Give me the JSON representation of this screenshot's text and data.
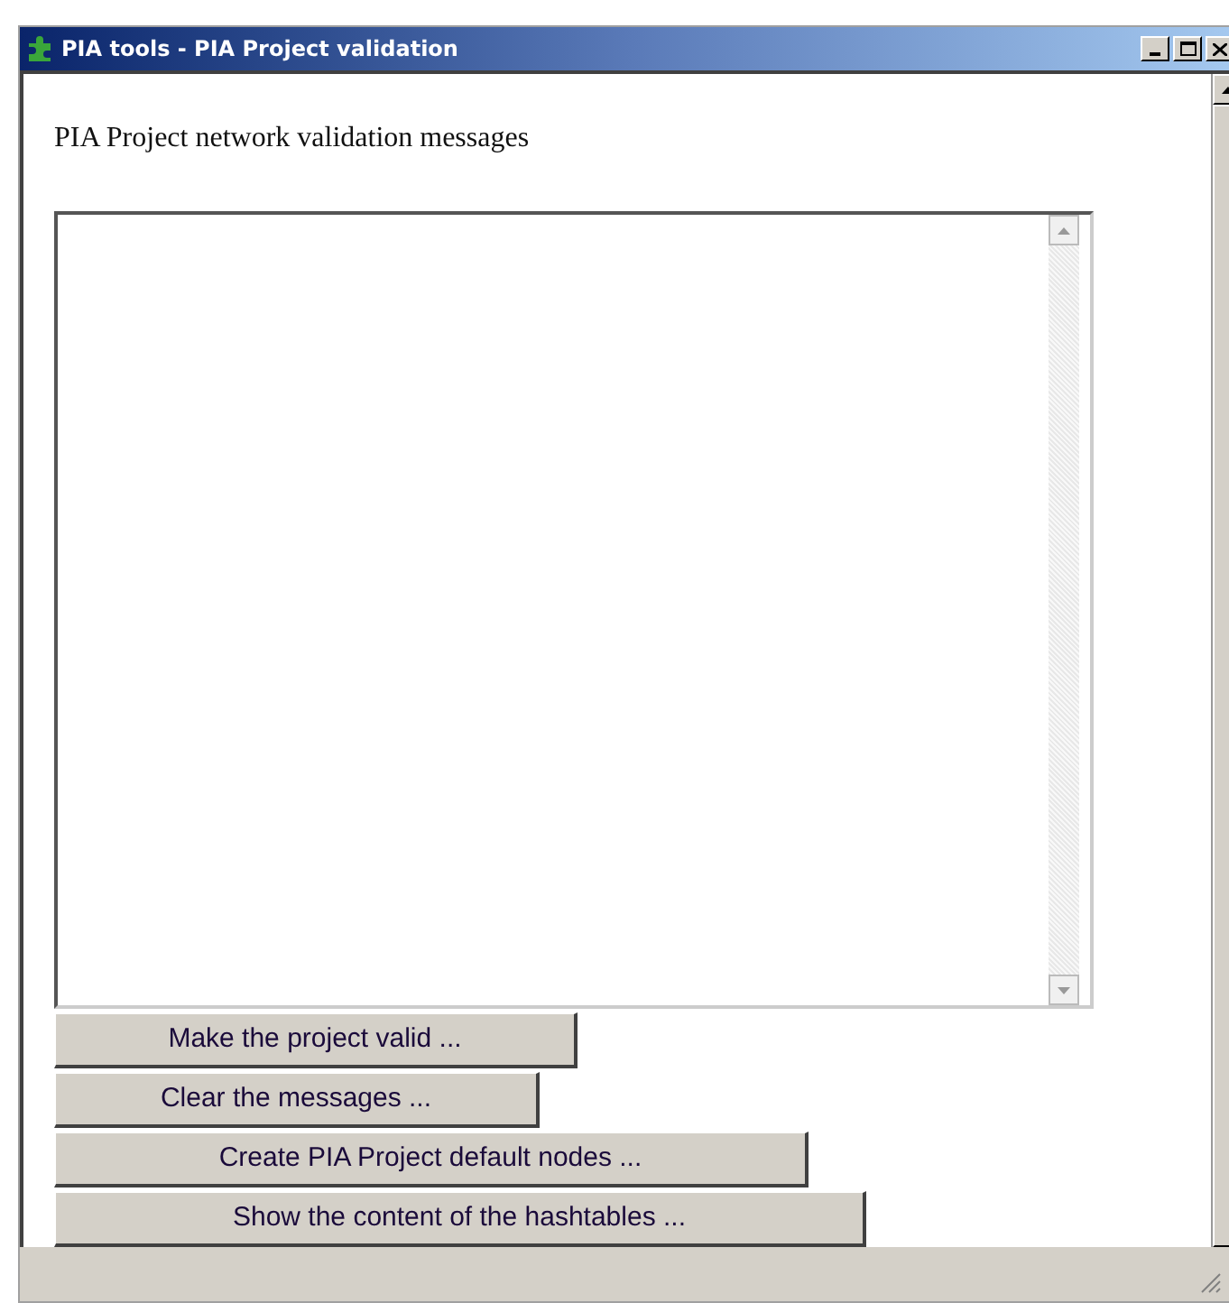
{
  "window": {
    "title": "PIA tools - PIA Project validation"
  },
  "heading": "PIA Project network validation messages",
  "buttons": [
    "Make the project valid ...",
    "Clear the messages ...",
    "Create PIA Project default nodes ...",
    "Show the content of the hashtables ..."
  ]
}
